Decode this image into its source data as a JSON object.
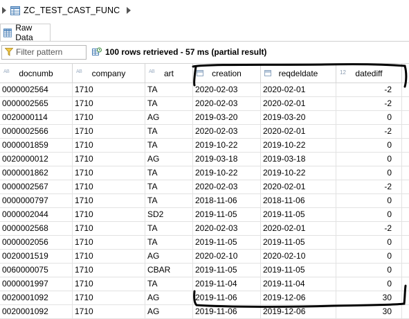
{
  "breadcrumb": {
    "title": "ZC_TEST_CAST_FUNC",
    "table_icon": "table-icon"
  },
  "tab": {
    "label": "Raw Data",
    "icon": "grid-icon"
  },
  "toolbar": {
    "filter_placeholder": "Filter pattern",
    "status": "100 rows retrieved - 57 ms (partial result)"
  },
  "grid": {
    "columns": [
      {
        "label": "docnumb",
        "type": "string"
      },
      {
        "label": "company",
        "type": "string"
      },
      {
        "label": "art",
        "type": "string"
      },
      {
        "label": "creation",
        "type": "date"
      },
      {
        "label": "reqdeldate",
        "type": "date"
      },
      {
        "label": "datediff",
        "type": "number",
        "type_label": "12"
      }
    ],
    "rows": [
      [
        "0000002564",
        "1710",
        "TA",
        "2020-02-03",
        "2020-02-01",
        "-2"
      ],
      [
        "0000002565",
        "1710",
        "TA",
        "2020-02-03",
        "2020-02-01",
        "-2"
      ],
      [
        "0020000114",
        "1710",
        "AG",
        "2019-03-20",
        "2019-03-20",
        "0"
      ],
      [
        "0000002566",
        "1710",
        "TA",
        "2020-02-03",
        "2020-02-01",
        "-2"
      ],
      [
        "0000001859",
        "1710",
        "TA",
        "2019-10-22",
        "2019-10-22",
        "0"
      ],
      [
        "0020000012",
        "1710",
        "AG",
        "2019-03-18",
        "2019-03-18",
        "0"
      ],
      [
        "0000001862",
        "1710",
        "TA",
        "2019-10-22",
        "2019-10-22",
        "0"
      ],
      [
        "0000002567",
        "1710",
        "TA",
        "2020-02-03",
        "2020-02-01",
        "-2"
      ],
      [
        "0000000797",
        "1710",
        "TA",
        "2018-11-06",
        "2018-11-06",
        "0"
      ],
      [
        "0000002044",
        "1710",
        "SD2",
        "2019-11-05",
        "2019-11-05",
        "0"
      ],
      [
        "0000002568",
        "1710",
        "TA",
        "2020-02-03",
        "2020-02-01",
        "-2"
      ],
      [
        "0000002056",
        "1710",
        "TA",
        "2019-11-05",
        "2019-11-05",
        "0"
      ],
      [
        "0020001519",
        "1710",
        "AG",
        "2020-02-10",
        "2020-02-10",
        "0"
      ],
      [
        "0060000075",
        "1710",
        "CBAR",
        "2019-11-05",
        "2019-11-05",
        "0"
      ],
      [
        "0000001997",
        "1710",
        "TA",
        "2019-11-04",
        "2019-11-04",
        "0"
      ],
      [
        "0020001092",
        "1710",
        "AG",
        "2019-11-06",
        "2019-12-06",
        "30"
      ],
      [
        "0020001092",
        "1710",
        "AG",
        "2019-11-06",
        "2019-12-06",
        "30"
      ]
    ]
  },
  "colors": {
    "annotation": "#000000",
    "header_type_icon": "#9fb0c4",
    "table_icon": "#4a7fb5"
  }
}
